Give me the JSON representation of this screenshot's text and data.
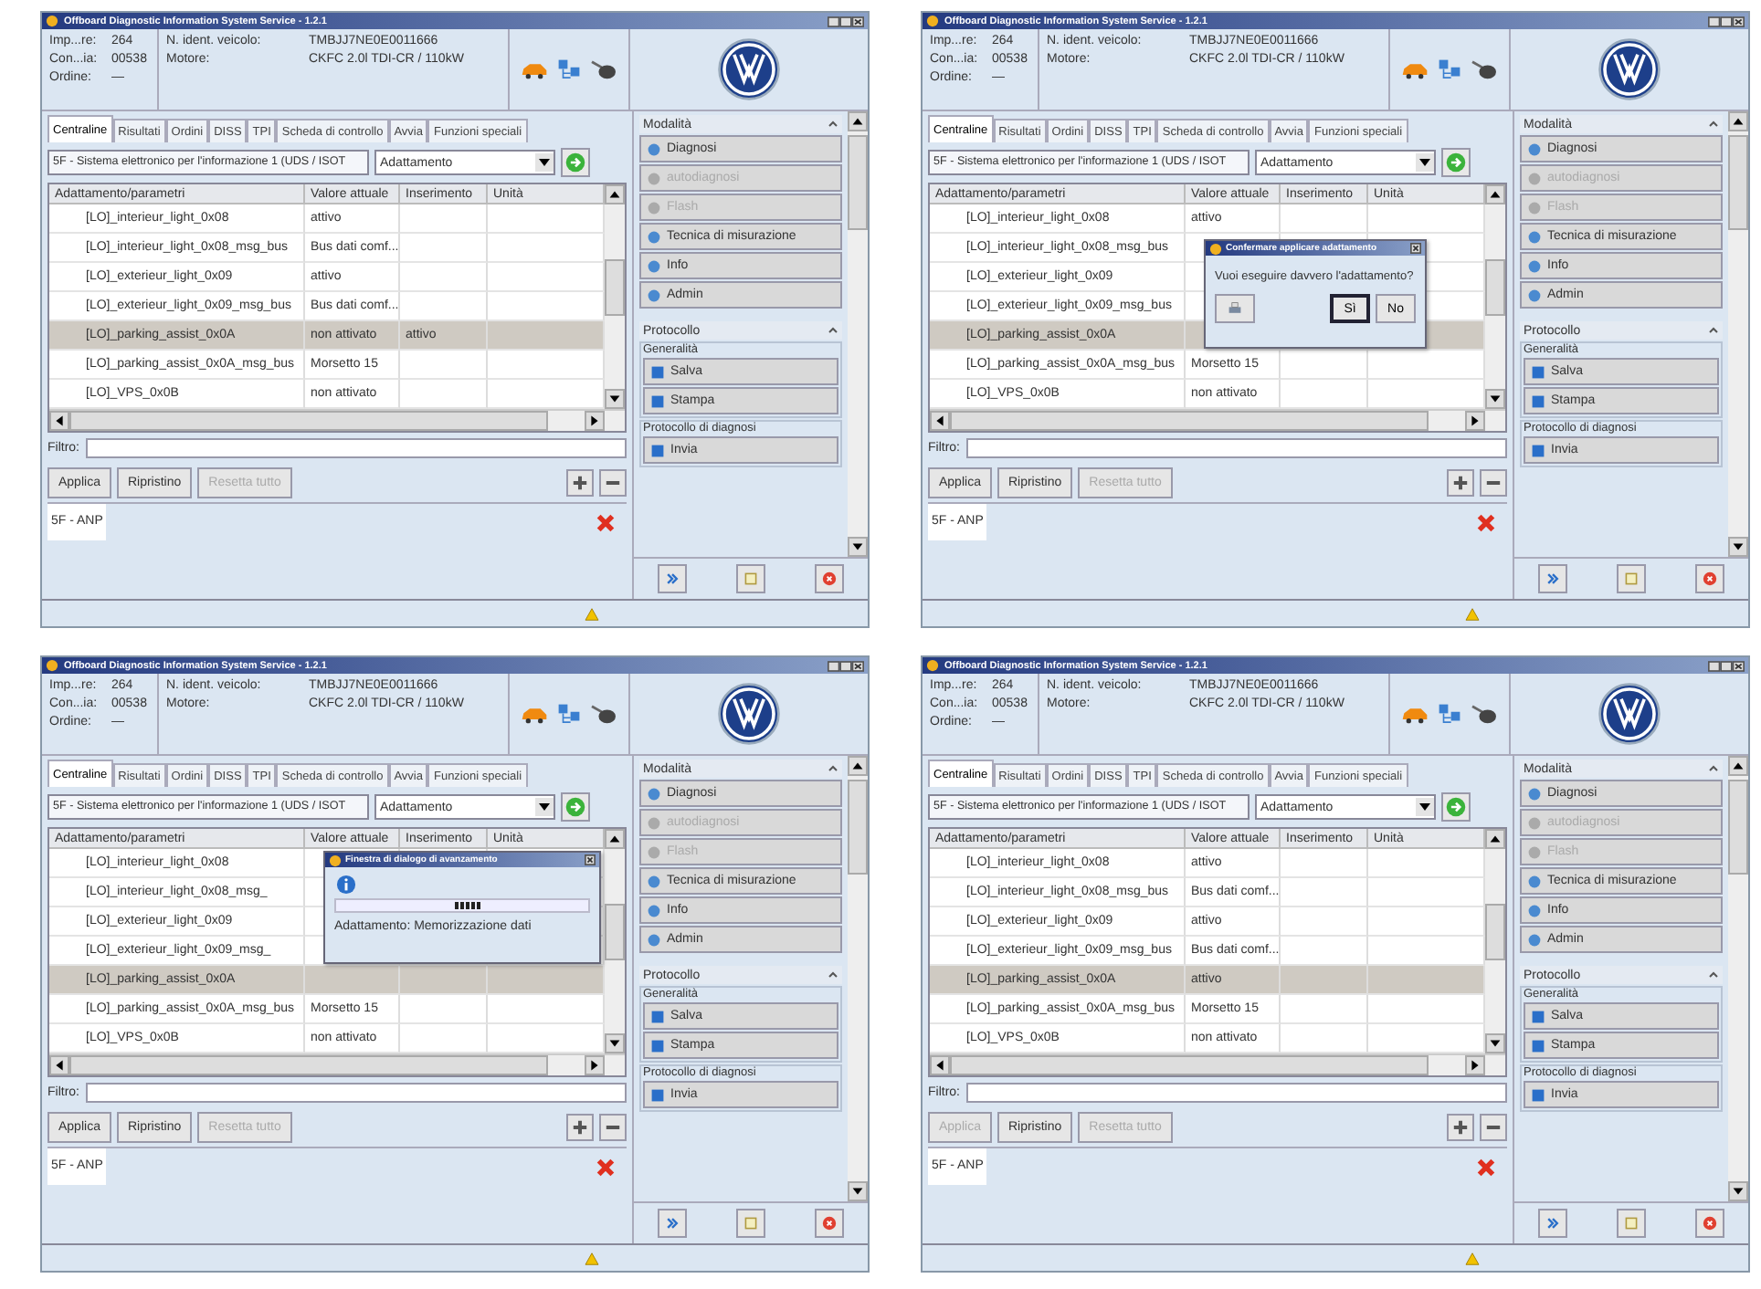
{
  "screens": [
    {
      "title": "Offboard Diagnostic Information System Service - 1.2.1",
      "info": [
        {
          "label": "Imp...re:",
          "value": "264"
        },
        {
          "label": "Con...ia:",
          "value": "00538"
        },
        {
          "label": "Ordine:",
          "value": "—"
        }
      ],
      "vehicle": [
        {
          "label": "N. ident. veicolo:",
          "value": "TMBJJ7NE0E0011666"
        },
        {
          "label": "Motore:",
          "value": "CKFC 2.0l TDI-CR / 110kW"
        }
      ],
      "tabs": [
        {
          "label": "Centraline",
          "selected": true
        },
        {
          "label": "Risultati",
          "selected": false
        },
        {
          "label": "Ordini",
          "selected": false
        },
        {
          "label": "DISS",
          "selected": false
        },
        {
          "label": "TPI",
          "selected": false
        },
        {
          "label": "Scheda di controllo",
          "selected": false
        },
        {
          "label": "Avvia",
          "selected": false
        },
        {
          "label": "Funzioni speciali",
          "selected": false
        }
      ],
      "ecu": "5F - Sistema elettronico per l'informazione 1 (UDS / ISOT",
      "mode": "Adattamento",
      "columns": [
        "Adattamento/parametri",
        "Valore attuale",
        "Inserimento",
        "Unità"
      ],
      "rows": [
        {
          "name": "[LO]_interieur_light_0x08",
          "value": "attivo",
          "selected": false
        },
        {
          "name": "[LO]_interieur_light_0x08_msg_bus",
          "value": "Bus dati comf...",
          "selected": false
        },
        {
          "name": "[LO]_exterieur_light_0x09",
          "value": "attivo",
          "selected": false
        },
        {
          "name": "[LO]_exterieur_light_0x09_msg_bus",
          "value": "Bus dati comf...",
          "selected": false
        },
        {
          "name": "[LO]_parking_assist_0x0A",
          "value": "non attivato",
          "input": "attivo",
          "selected": true
        },
        {
          "name": "[LO]_parking_assist_0x0A_msg_bus",
          "value": "Morsetto 15",
          "selected": false
        },
        {
          "name": "[LO]_VPS_0x0B",
          "value": "non attivato",
          "selected": false
        }
      ],
      "filter_label": "Filtro:",
      "actions": [
        {
          "label": "Applica",
          "disabled": false
        },
        {
          "label": "Ripristino",
          "disabled": false
        },
        {
          "label": "Resetta tutto",
          "disabled": true
        }
      ],
      "session_tab": "5F - ANP",
      "modes_title": "Modalità",
      "modes": [
        {
          "label": "Diagnosi",
          "disabled": false
        },
        {
          "label": "autodiagnosi",
          "disabled": true
        },
        {
          "label": "Flash",
          "disabled": true
        },
        {
          "label": "Tecnica di misurazione",
          "disabled": false
        },
        {
          "label": "Info",
          "disabled": false
        },
        {
          "label": "Admin",
          "disabled": false
        }
      ],
      "protocol_title": "Protocollo",
      "groups": [
        {
          "title": "Generalità",
          "buttons": [
            "Salva",
            "Stampa"
          ]
        },
        {
          "title": "Protocollo di diagnosi",
          "buttons": [
            "Invia"
          ]
        }
      ]
    },
    {
      "title": "Offboard Diagnostic Information System Service - 1.2.1",
      "info": [
        {
          "label": "Imp...re:",
          "value": "264"
        },
        {
          "label": "Con...ia:",
          "value": "00538"
        },
        {
          "label": "Ordine:",
          "value": "—"
        }
      ],
      "vehicle": [
        {
          "label": "N. ident. veicolo:",
          "value": "TMBJJ7NE0E0011666"
        },
        {
          "label": "Motore:",
          "value": "CKFC 2.0l TDI-CR / 110kW"
        }
      ],
      "tabs": [
        {
          "label": "Centraline",
          "selected": true
        },
        {
          "label": "Risultati",
          "selected": false
        },
        {
          "label": "Ordini",
          "selected": false
        },
        {
          "label": "DISS",
          "selected": false
        },
        {
          "label": "TPI",
          "selected": false
        },
        {
          "label": "Scheda di controllo",
          "selected": false
        },
        {
          "label": "Avvia",
          "selected": false
        },
        {
          "label": "Funzioni speciali",
          "selected": false
        }
      ],
      "ecu": "5F - Sistema elettronico per l'informazione 1 (UDS / ISOT",
      "mode": "Adattamento",
      "columns": [
        "Adattamento/parametri",
        "Valore attuale",
        "Inserimento",
        "Unità"
      ],
      "rows": [
        {
          "name": "[LO]_interieur_light_0x08",
          "value": "attivo",
          "selected": false
        },
        {
          "name": "[LO]_interieur_light_0x08_msg_bus",
          "selected": false
        },
        {
          "name": "[LO]_exterieur_light_0x09",
          "selected": false
        },
        {
          "name": "[LO]_exterieur_light_0x09_msg_bus",
          "selected": false
        },
        {
          "name": "[LO]_parking_assist_0x0A",
          "selected": true
        },
        {
          "name": "[LO]_parking_assist_0x0A_msg_bus",
          "value": "Morsetto 15",
          "selected": false
        },
        {
          "name": "[LO]_VPS_0x0B",
          "value": "non attivato",
          "selected": false
        }
      ],
      "filter_label": "Filtro:",
      "actions": [
        {
          "label": "Applica",
          "disabled": false
        },
        {
          "label": "Ripristino",
          "disabled": false
        },
        {
          "label": "Resetta tutto",
          "disabled": true
        }
      ],
      "session_tab": "5F - ANP",
      "modes_title": "Modalità",
      "modes": [
        {
          "label": "Diagnosi",
          "disabled": false
        },
        {
          "label": "autodiagnosi",
          "disabled": true
        },
        {
          "label": "Flash",
          "disabled": true
        },
        {
          "label": "Tecnica di misurazione",
          "disabled": false
        },
        {
          "label": "Info",
          "disabled": false
        },
        {
          "label": "Admin",
          "disabled": false
        }
      ],
      "protocol_title": "Protocollo",
      "groups": [
        {
          "title": "Generalità",
          "buttons": [
            "Salva",
            "Stampa"
          ]
        },
        {
          "title": "Protocollo di diagnosi",
          "buttons": [
            "Invia"
          ]
        }
      ],
      "dialog": {
        "kind": "confirm",
        "title": "Confermare applicare adattamento",
        "message": "Vuoi eseguire davvero l'adattamento?",
        "buttons": [
          {
            "label": "Sì",
            "selected": true
          },
          {
            "label": "No",
            "selected": false
          }
        ]
      }
    },
    {
      "title": "Offboard Diagnostic Information System Service - 1.2.1",
      "info": [
        {
          "label": "Imp...re:",
          "value": "264"
        },
        {
          "label": "Con...ia:",
          "value": "00538"
        },
        {
          "label": "Ordine:",
          "value": "—"
        }
      ],
      "vehicle": [
        {
          "label": "N. ident. veicolo:",
          "value": "TMBJJ7NE0E0011666"
        },
        {
          "label": "Motore:",
          "value": "CKFC 2.0l TDI-CR / 110kW"
        }
      ],
      "tabs": [
        {
          "label": "Centraline",
          "selected": true
        },
        {
          "label": "Risultati",
          "selected": false
        },
        {
          "label": "Ordini",
          "selected": false
        },
        {
          "label": "DISS",
          "selected": false
        },
        {
          "label": "TPI",
          "selected": false
        },
        {
          "label": "Scheda di controllo",
          "selected": false
        },
        {
          "label": "Avvia",
          "selected": false
        },
        {
          "label": "Funzioni speciali",
          "selected": false
        }
      ],
      "ecu": "5F - Sistema elettronico per l'informazione 1 (UDS / ISOT",
      "mode": "Adattamento",
      "columns": [
        "Adattamento/parametri",
        "Valore attuale",
        "Inserimento",
        "Unità"
      ],
      "rows": [
        {
          "name": "[LO]_interieur_light_0x08",
          "selected": false
        },
        {
          "name": "[LO]_interieur_light_0x08_msg_",
          "selected": false
        },
        {
          "name": "[LO]_exterieur_light_0x09",
          "selected": false
        },
        {
          "name": "[LO]_exterieur_light_0x09_msg_",
          "selected": false
        },
        {
          "name": "[LO]_parking_assist_0x0A",
          "selected": true
        },
        {
          "name": "[LO]_parking_assist_0x0A_msg_bus",
          "value": "Morsetto 15",
          "selected": false
        },
        {
          "name": "[LO]_VPS_0x0B",
          "value": "non attivato",
          "selected": false
        }
      ],
      "filter_label": "Filtro:",
      "actions": [
        {
          "label": "Applica",
          "disabled": false
        },
        {
          "label": "Ripristino",
          "disabled": false
        },
        {
          "label": "Resetta tutto",
          "disabled": true
        }
      ],
      "session_tab": "5F - ANP",
      "modes_title": "Modalità",
      "modes": [
        {
          "label": "Diagnosi",
          "disabled": false
        },
        {
          "label": "autodiagnosi",
          "disabled": true
        },
        {
          "label": "Flash",
          "disabled": true
        },
        {
          "label": "Tecnica di misurazione",
          "disabled": false
        },
        {
          "label": "Info",
          "disabled": false
        },
        {
          "label": "Admin",
          "disabled": false
        }
      ],
      "protocol_title": "Protocollo",
      "groups": [
        {
          "title": "Generalità",
          "buttons": [
            "Salva",
            "Stampa"
          ]
        },
        {
          "title": "Protocollo di diagnosi",
          "buttons": [
            "Invia"
          ]
        }
      ],
      "dialog": {
        "kind": "progress",
        "title": "Finestra di dialogo di avanzamento",
        "message": "Adattamento: Memorizzazione dati",
        "level": 0.57
      }
    },
    {
      "title": "Offboard Diagnostic Information System Service - 1.2.1",
      "info": [
        {
          "label": "Imp...re:",
          "value": "264"
        },
        {
          "label": "Con...ia:",
          "value": "00538"
        },
        {
          "label": "Ordine:",
          "value": "—"
        }
      ],
      "vehicle": [
        {
          "label": "N. ident. veicolo:",
          "value": "TMBJJ7NE0E0011666"
        },
        {
          "label": "Motore:",
          "value": "CKFC 2.0l TDI-CR / 110kW"
        }
      ],
      "tabs": [
        {
          "label": "Centraline",
          "selected": true
        },
        {
          "label": "Risultati",
          "selected": false
        },
        {
          "label": "Ordini",
          "selected": false
        },
        {
          "label": "DISS",
          "selected": false
        },
        {
          "label": "TPI",
          "selected": false
        },
        {
          "label": "Scheda di controllo",
          "selected": false
        },
        {
          "label": "Avvia",
          "selected": false
        },
        {
          "label": "Funzioni speciali",
          "selected": false
        }
      ],
      "ecu": "5F - Sistema elettronico per l'informazione 1 (UDS / ISOT",
      "mode": "Adattamento",
      "columns": [
        "Adattamento/parametri",
        "Valore attuale",
        "Inserimento",
        "Unità"
      ],
      "rows": [
        {
          "name": "[LO]_interieur_light_0x08",
          "value": "attivo",
          "selected": false
        },
        {
          "name": "[LO]_interieur_light_0x08_msg_bus",
          "value": "Bus dati comf...",
          "selected": false
        },
        {
          "name": "[LO]_exterieur_light_0x09",
          "value": "attivo",
          "selected": false
        },
        {
          "name": "[LO]_exterieur_light_0x09_msg_bus",
          "value": "Bus dati comf...",
          "selected": false
        },
        {
          "name": "[LO]_parking_assist_0x0A",
          "value": "attivo",
          "selected": true
        },
        {
          "name": "[LO]_parking_assist_0x0A_msg_bus",
          "value": "Morsetto 15",
          "selected": false
        },
        {
          "name": "[LO]_VPS_0x0B",
          "value": "non attivato",
          "selected": false
        }
      ],
      "filter_label": "Filtro:",
      "actions": [
        {
          "label": "Applica",
          "disabled": true
        },
        {
          "label": "Ripristino",
          "disabled": false
        },
        {
          "label": "Resetta tutto",
          "disabled": true
        }
      ],
      "session_tab": "5F - ANP",
      "modes_title": "Modalità",
      "modes": [
        {
          "label": "Diagnosi",
          "disabled": false
        },
        {
          "label": "autodiagnosi",
          "disabled": true
        },
        {
          "label": "Flash",
          "disabled": true
        },
        {
          "label": "Tecnica di misurazione",
          "disabled": false
        },
        {
          "label": "Info",
          "disabled": false
        },
        {
          "label": "Admin",
          "disabled": false
        }
      ],
      "protocol_title": "Protocollo",
      "groups": [
        {
          "title": "Generalità",
          "buttons": [
            "Salva",
            "Stampa"
          ]
        },
        {
          "title": "Protocollo di diagnosi",
          "buttons": [
            "Invia"
          ]
        }
      ]
    }
  ]
}
